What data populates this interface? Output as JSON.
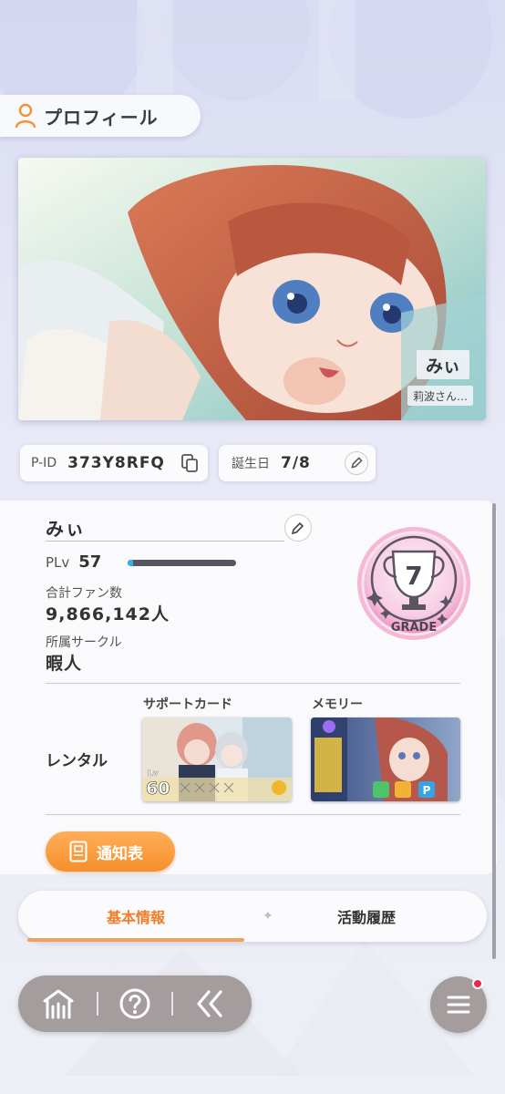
{
  "header": {
    "title": "プロフィール",
    "icon": "person-icon"
  },
  "card": {
    "name": "みぃ",
    "subtitle": "莉波さん…"
  },
  "ids": {
    "pid_label": "P-ID",
    "pid_value": "373Y8RFQ",
    "copy_icon": "copy-icon",
    "birthday_label": "誕生日",
    "birthday_value": "7/8",
    "edit_icon": "pencil-icon"
  },
  "profile": {
    "name": "みぃ",
    "plv_label": "PLv",
    "plv_value": "57",
    "plv_progress": 0.05,
    "fans_label": "合計ファン数",
    "fans_value": "9,866,142人",
    "circle_label": "所属サークル",
    "circle_value": "暇人"
  },
  "grade": {
    "number": "7",
    "label": "GRADE"
  },
  "rental": {
    "label": "レンタル",
    "support_label": "サポートカード",
    "memory_label": "メモリー",
    "support_level": "Lv",
    "support_level_value": "60"
  },
  "report_button": {
    "label": "通知表"
  },
  "tabs": {
    "active": "基本情報",
    "other": "活動履歴",
    "separator": "✦"
  },
  "colors": {
    "accent": "#f58f2c",
    "nav": "#a59c9e",
    "badge": "#e8294a",
    "bar": "#3fa9e6"
  }
}
